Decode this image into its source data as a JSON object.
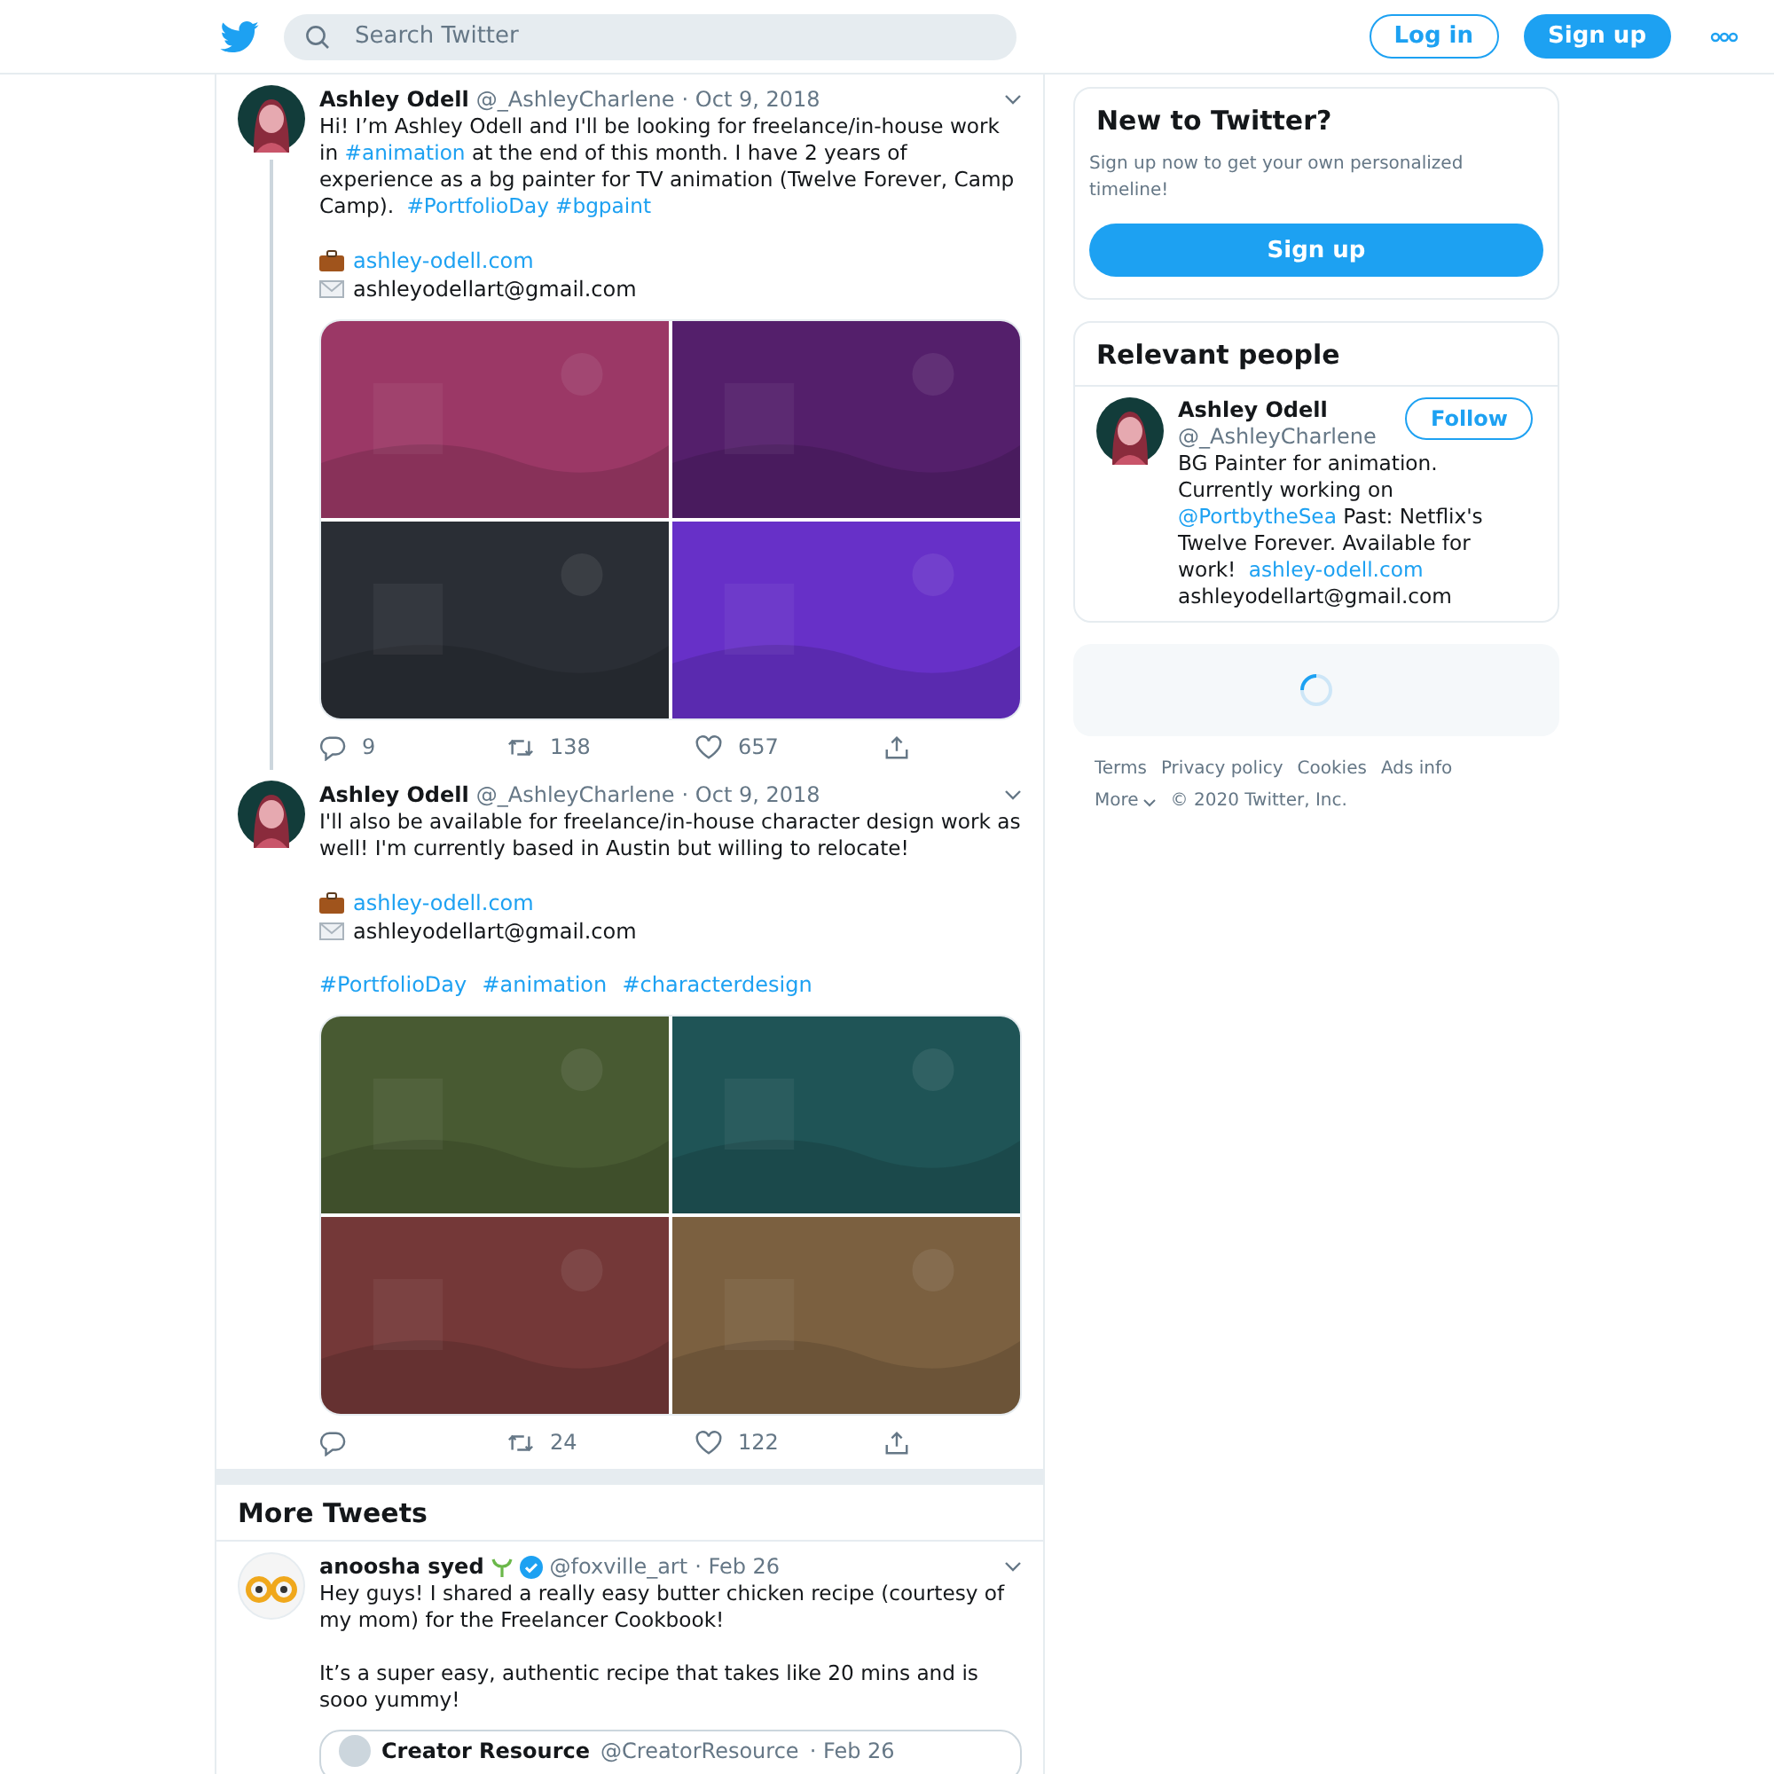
{
  "header": {
    "search": {
      "placeholder": "Search Twitter"
    },
    "login": "Log in",
    "signup": "Sign up"
  },
  "thread": [
    {
      "name": "Ashley Odell",
      "handle": "@_AshleyCharlene",
      "date": "· Oct 9, 2018",
      "text": [
        {
          "text": "Hi! I’m Ashley Odell and I'll be looking for freelance/in-house work in ",
          "kind": "plain"
        },
        {
          "text": "#animation",
          "kind": "link"
        },
        {
          "text": " at the end of this month. I have 2 years of experience as a bg painter for TV animation (Twelve Forever, Camp Camp). ",
          "kind": "plain"
        },
        {
          "text": "#PortfolioDay",
          "kind": "link"
        },
        {
          "text": "#bgpaint",
          "kind": "link"
        }
      ],
      "website": "ashley-odell.com",
      "email": "ashleyodellart@gmail.com",
      "media": [
        {
          "kind": "picture"
        },
        {
          "kind": "picture"
        },
        {
          "kind": "picture"
        },
        {
          "kind": "picture"
        }
      ],
      "replies": "9",
      "retweets": "138",
      "likes": "657",
      "thread_line": true
    },
    {
      "name": "Ashley Odell",
      "handle": "@_AshleyCharlene",
      "date": "· Oct 9, 2018",
      "text": [
        {
          "text": "I'll also be available for freelance/in-house character design work as well! I'm currently based in Austin but willing to relocate!",
          "kind": "plain"
        }
      ],
      "website": "ashley-odell.com",
      "email": "ashleyodellart@gmail.com",
      "tags": [
        "#PortfolioDay",
        "#animation",
        "#characterdesign"
      ],
      "media": [
        {
          "kind": "picture"
        },
        {
          "kind": "picture"
        },
        {
          "kind": "picture"
        },
        {
          "kind": "picture"
        }
      ],
      "retweets": "24",
      "likes": "122",
      "thread_line": false
    }
  ],
  "more_tweets": {
    "title": "More Tweets",
    "tweet": {
      "name": "anoosha syed",
      "verified": true,
      "handle": "@foxville_art",
      "date": "· Feb 26",
      "paragraphs": [
        "Hey guys! I shared a really easy butter chicken recipe (courtesy of my mom) for the Freelancer Cookbook!",
        "It’s a super easy, authentic recipe that takes like 20 mins and is sooo yummy!"
      ],
      "quote": {
        "name": "Creator Resource",
        "handle": "@CreatorResource",
        "date": "· Feb 26"
      }
    }
  },
  "sidebar": {
    "signup_card": {
      "title": "New to Twitter?",
      "text": "Sign up now to get your own personalized timeline!",
      "button": "Sign up"
    },
    "people": {
      "title": "Relevant people",
      "person": {
        "name": "Ashley Odell",
        "handle": "@_AshleyCharlene",
        "follow": "Follow",
        "bio": [
          {
            "text": "BG Painter for animation. Currently working on ",
            "kind": "plain"
          },
          {
            "text": "@PortbytheSea",
            "kind": "link"
          },
          {
            "text": " Past: Netflix's Twelve Forever. Available for work! ",
            "kind": "plain"
          },
          {
            "text": "ashley-odell.com",
            "kind": "link"
          },
          {
            "text": " ashleyodellart@gmail.com",
            "kind": "plain"
          }
        ]
      }
    },
    "footer": {
      "links": [
        "Terms",
        "Privacy policy",
        "Cookies",
        "Ads info"
      ],
      "more": "More",
      "copyright": "© 2020 Twitter, Inc."
    }
  }
}
